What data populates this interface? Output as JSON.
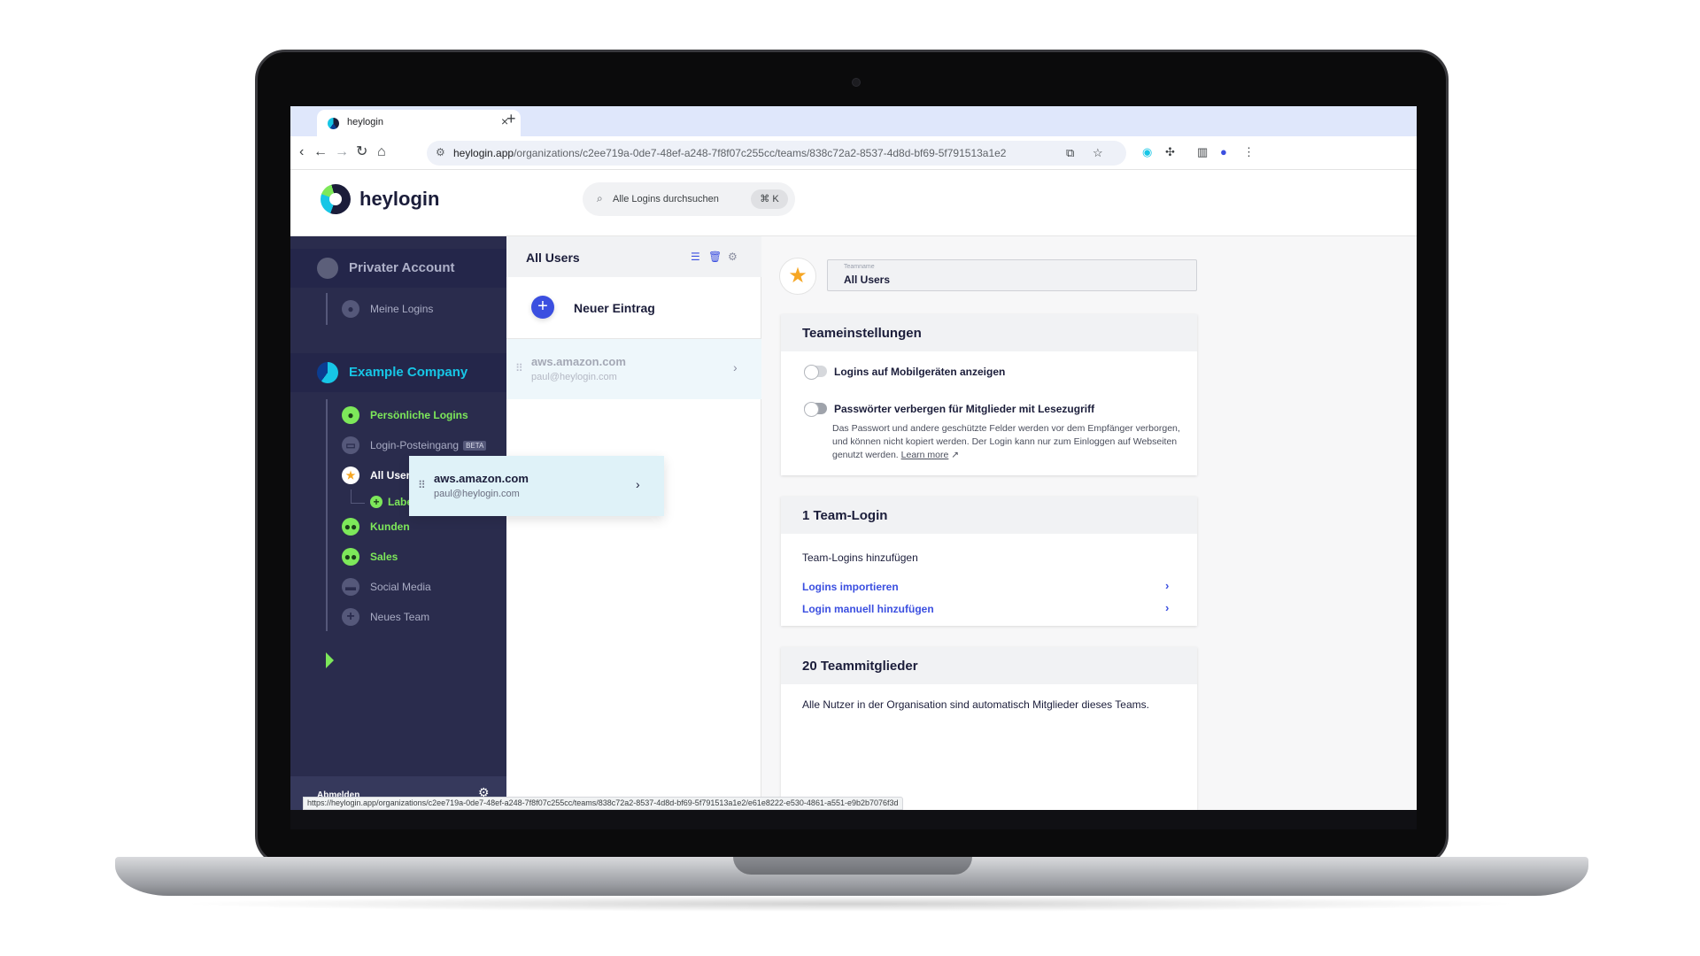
{
  "browser": {
    "tab_title": "heylogin",
    "tab_close": "×",
    "tab_new": "+",
    "url_host": "heylogin.app",
    "url_path": "/organizations/c2ee719a-0de7-48ef-a248-7f8f07c255cc/teams/838c72a2-8537-4d8d-bf69-5f791513a1e2",
    "status_url": "https://heylogin.app/organizations/c2ee719a-0de7-48ef-a248-7f8f07c255cc/teams/838c72a2-8537-4d8d-bf69-5f791513a1e2/e61e8222-e530-4861-a551-e9b2b7076f3d",
    "icons": [
      "back-arrow-icon",
      "forward-arrow-icon",
      "reload-icon",
      "home-icon",
      "bookmark-star-icon",
      "extensions-icon"
    ]
  },
  "header": {
    "logo_text": "heylogin",
    "search_placeholder": "Alle Logins durchsuchen",
    "shortcut": "⌘ K"
  },
  "sidebar": {
    "private_section": "Privater Account",
    "private_items": [
      {
        "label": "Meine Logins"
      }
    ],
    "company_section": "Example Company",
    "company_items": [
      {
        "label": "Persönliche Logins"
      },
      {
        "label": "Login-Posteingang",
        "badge": "BETA"
      },
      {
        "label": "All Users"
      },
      {
        "label": "Label hinzufügen"
      },
      {
        "label": "Kunden"
      },
      {
        "label": "Sales"
      },
      {
        "label": "Social Media"
      },
      {
        "label": "Neues Team"
      }
    ],
    "footer_label": "Abmelden"
  },
  "list": {
    "title": "All Users",
    "new_entry": "Neuer Eintrag",
    "entries": [
      {
        "title": "aws.amazon.com",
        "subtitle": "paul@heylogin.com"
      }
    ],
    "drag_ghost": {
      "title": "aws.amazon.com",
      "subtitle": "paul@heylogin.com"
    }
  },
  "team": {
    "name_caption": "Teamname",
    "name_value": "All Users",
    "settings": {
      "title": "Teameinstellungen",
      "toggle1": "Logins auf Mobilgeräten anzeigen",
      "toggle2": "Passwörter verbergen für Mitglieder mit Lesezugriff",
      "description": "Das Passwort und andere geschützte Felder werden vor dem Empfänger verborgen, und können nicht kopiert werden. Der Login kann nur zum Einloggen auf Webseiten genutzt werden.",
      "learn_more": "Learn more"
    },
    "logins": {
      "title": "1 Team-Login",
      "subtitle": "Team-Logins hinzufügen",
      "link1": "Logins importieren",
      "link2": "Login manuell hinzufügen"
    },
    "members": {
      "title": "20 Teammitglieder",
      "text": "Alle Nutzer in der Organisation sind automatisch Mitglieder dieses Teams."
    }
  },
  "colors": {
    "sidebar_bg": "#2a2c4d",
    "accent_green": "#7de85a",
    "accent_cyan": "#17c6e6",
    "link_blue": "#3b4fe0",
    "star": "#f6a623"
  }
}
